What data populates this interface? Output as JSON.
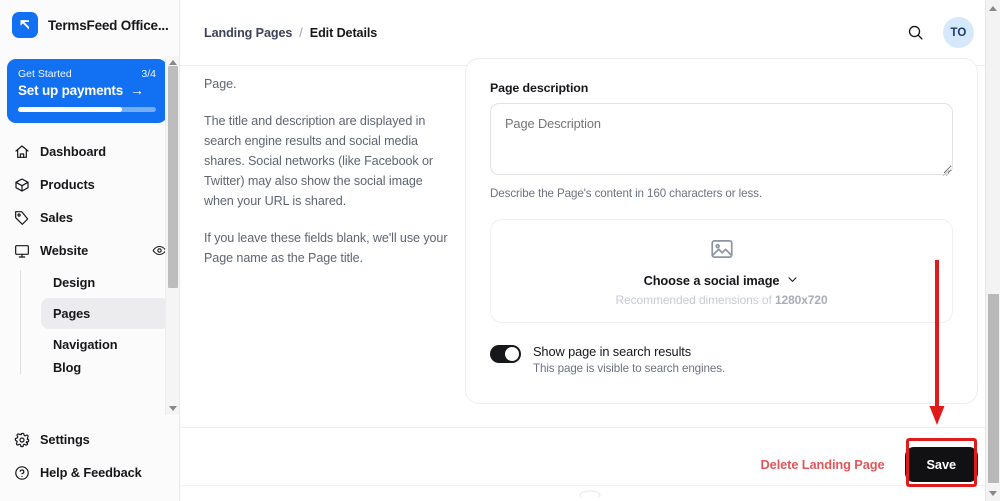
{
  "sidebar": {
    "brand": {
      "name": "TermsFeed Office...",
      "logo_icon": "termsfeed-logo-icon",
      "accent": "#1171f2"
    },
    "get_started": {
      "label": "Get Started",
      "count": "3/4",
      "title": "Set up payments",
      "arrow": "→",
      "progress_percent": 75
    },
    "nav": [
      {
        "label": "Dashboard",
        "icon": "home-icon"
      },
      {
        "label": "Products",
        "icon": "box-icon"
      },
      {
        "label": "Sales",
        "icon": "tag-icon"
      },
      {
        "label": "Website",
        "icon": "monitor-icon",
        "trailing_icon": "eye-icon"
      }
    ],
    "subnav": [
      {
        "label": "Design",
        "active": false
      },
      {
        "label": "Pages",
        "active": true
      },
      {
        "label": "Navigation",
        "active": false
      },
      {
        "label": "Blog",
        "active": false
      }
    ],
    "bottom_nav": [
      {
        "label": "Settings",
        "icon": "gear-icon"
      },
      {
        "label": "Help & Feedback",
        "icon": "question-circle-icon"
      }
    ]
  },
  "header": {
    "breadcrumb": {
      "parent": "Landing Pages",
      "separator": "/",
      "current": "Edit Details"
    },
    "search_icon": "search-icon",
    "avatar_initials": "TO"
  },
  "help_column": {
    "paragraphs": [
      "Page.",
      "The title and description are displayed in search engine results and social media shares. Social networks (like Facebook or Twitter) may also show the social image when your URL is shared.",
      "If you leave these fields blank, we'll use your Page name as the Page title."
    ]
  },
  "form": {
    "description": {
      "label": "Page description",
      "value": "",
      "placeholder": "Page Description",
      "hint": "Describe the Page's content in 160 characters or less."
    },
    "social_image": {
      "icon": "image-placeholder-icon",
      "title": "Choose a social image",
      "chevron_icon": "chevron-down-icon",
      "recommendation_prefix": "Recommended dimensions of ",
      "recommendation_value": "1280x720"
    },
    "search_visibility": {
      "label": "Show page in search results",
      "description": "This page is visible to search engines.",
      "enabled": true
    }
  },
  "footer": {
    "delete_label": "Delete Landing Page",
    "delete_color": "#e0575b",
    "save_label": "Save",
    "save_bg": "#111113"
  },
  "annotations": {
    "arrow_color": "#e01b1b",
    "highlight_color": "#e01b1b"
  }
}
